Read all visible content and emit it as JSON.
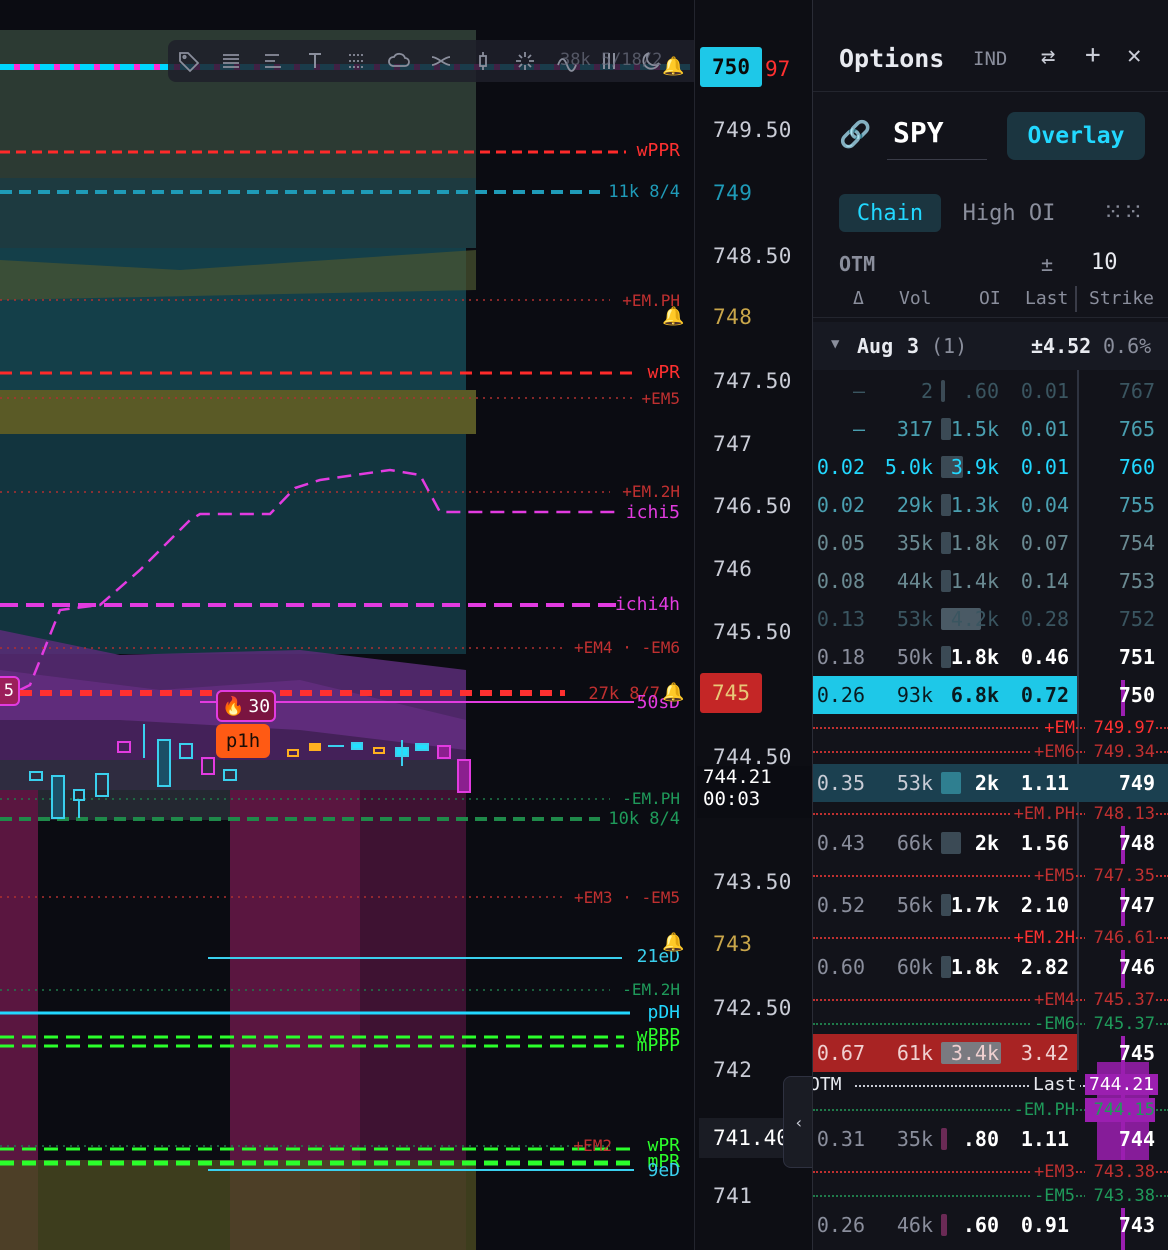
{
  "chart": {
    "toolbar_partial_text": "38k 5/18/2",
    "toolbar_icons": [
      "tag-icon",
      "lines-icon",
      "align-icon",
      "text-icon",
      "dotted-lines-icon",
      "cloud-icon",
      "cross-lines-icon",
      "candle-icon",
      "sparkle-icon",
      "wave-icon",
      "bars-icon",
      "moon-icon"
    ],
    "labels": {
      "wpr_top": "wPPR",
      "vol_11k": "11k 8/4",
      "em_ph": "+EM.PH",
      "wpr": "wPR",
      "em5_top": "+EM5",
      "em_2h": "+EM.2H",
      "ichi5": "ichi5",
      "ichi4h": "ichi4h",
      "em4_em6": "+EM4 · -EM6",
      "vol_27k": "27k 8/7",
      "sd50": "50sD",
      "fire_badge": "30",
      "p1h": "p1h",
      "left_badge": "5",
      "neg_em_ph": "-EM.PH",
      "vol_10k": "10k 8/4",
      "em3_em5": "+EM3 · -EM5",
      "ed21": "21eD",
      "neg_em_2h": "-EM.2H",
      "pdh": "pDH",
      "wppp": "wPPP",
      "mppp": "mPPP",
      "em2": "+EM2",
      "wpr_low": "wPR",
      "mpr_low": "mPR",
      "ed9": "9eD"
    }
  },
  "axis": {
    "prices": [
      "749.50",
      "749",
      "748.50",
      "748",
      "747.50",
      "747",
      "746.50",
      "746",
      "745.50",
      "745",
      "744.50",
      "743.50",
      "743",
      "742.50",
      "742",
      "741.40",
      "741"
    ],
    "top_tag": "750",
    "top_tag_suffix": "97",
    "current_price": "744.21",
    "countdown": "00:03",
    "partial_price": "744",
    "red_tag": "745",
    "collapse_icon": "chevron-left-icon"
  },
  "panel": {
    "title": "Options",
    "ind": "IND",
    "symbol": "SPY",
    "overlay_button": "Overlay",
    "tabs": [
      "Chain",
      "High OI"
    ],
    "active_tab": "Chain",
    "otm_label": "OTM",
    "plus_minus": "±",
    "strike_count": "10",
    "columns": [
      "Δ",
      "Vol",
      "OI",
      "Last",
      "Strike"
    ],
    "expiry": {
      "label": "Aug",
      "day": "3",
      "count": "(1)",
      "move": "±4.52",
      "pct": "0.6%"
    },
    "rows_above": [
      {
        "delta": "–",
        "vol": "2",
        "oi": ".60",
        "last": "0.01",
        "strike": "767",
        "dim": true
      },
      {
        "delta": "–",
        "vol": "317",
        "oi": "1.5k",
        "last": "0.01",
        "strike": "765"
      },
      {
        "delta": "0.02",
        "vol": "5.0k",
        "oi": "3.9k",
        "last": "0.01",
        "strike": "760"
      },
      {
        "delta": "0.02",
        "vol": "29k",
        "oi": "1.3k",
        "last": "0.04",
        "strike": "755"
      },
      {
        "delta": "0.05",
        "vol": "35k",
        "oi": "1.8k",
        "last": "0.07",
        "strike": "754"
      },
      {
        "delta": "0.08",
        "vol": "44k",
        "oi": "1.4k",
        "last": "0.14",
        "strike": "753"
      },
      {
        "delta": "0.13",
        "vol": "53k",
        "oi": "4.2k",
        "last": "0.28",
        "strike": "752",
        "dim": true
      },
      {
        "delta": "0.18",
        "vol": "50k",
        "oi": "1.8k",
        "last": "0.46",
        "strike": "751"
      },
      {
        "delta": "0.26",
        "vol": "93k",
        "oi": "6.8k",
        "last": "0.72",
        "strike": "750"
      }
    ],
    "levels": [
      {
        "label": "+EM",
        "value": "749.97"
      },
      {
        "label": "+EM6",
        "value": "749.34"
      },
      {
        "label": "+EM.PH",
        "value": "748.13"
      },
      {
        "label": "+EM5",
        "value": "747.35"
      },
      {
        "label": "+EM.2H",
        "value": "746.61"
      },
      {
        "label": "+EM4",
        "value": "745.37"
      },
      {
        "label": "-EM6",
        "value": "745.37"
      },
      {
        "label": "-EM.PH",
        "value": "744.15"
      },
      {
        "label": "+EM3",
        "value": "743.38"
      },
      {
        "label": "-EM5",
        "value": "743.38"
      }
    ],
    "rows_mid": [
      {
        "delta": "0.35",
        "vol": "53k",
        "oi": "2k",
        "last": "1.11",
        "strike": "749"
      },
      {
        "delta": "0.43",
        "vol": "66k",
        "oi": "2k",
        "last": "1.56",
        "strike": "748"
      },
      {
        "delta": "0.52",
        "vol": "56k",
        "oi": "1.7k",
        "last": "2.10",
        "strike": "747"
      },
      {
        "delta": "0.60",
        "vol": "60k",
        "oi": "1.8k",
        "last": "2.82",
        "strike": "746"
      },
      {
        "delta": "0.67",
        "vol": "61k",
        "oi": "3.4k",
        "last": "3.42",
        "strike": "745"
      }
    ],
    "otm_line": {
      "otm": "OTM",
      "last_label": "Last",
      "last_value": "744.21"
    },
    "rows_below": [
      {
        "delta": "0.31",
        "vol": "35k",
        "oi": ".80",
        "last": "1.11",
        "strike": "744"
      },
      {
        "delta": "0.26",
        "vol": "46k",
        "oi": ".60",
        "last": "0.91",
        "strike": "743"
      }
    ]
  }
}
